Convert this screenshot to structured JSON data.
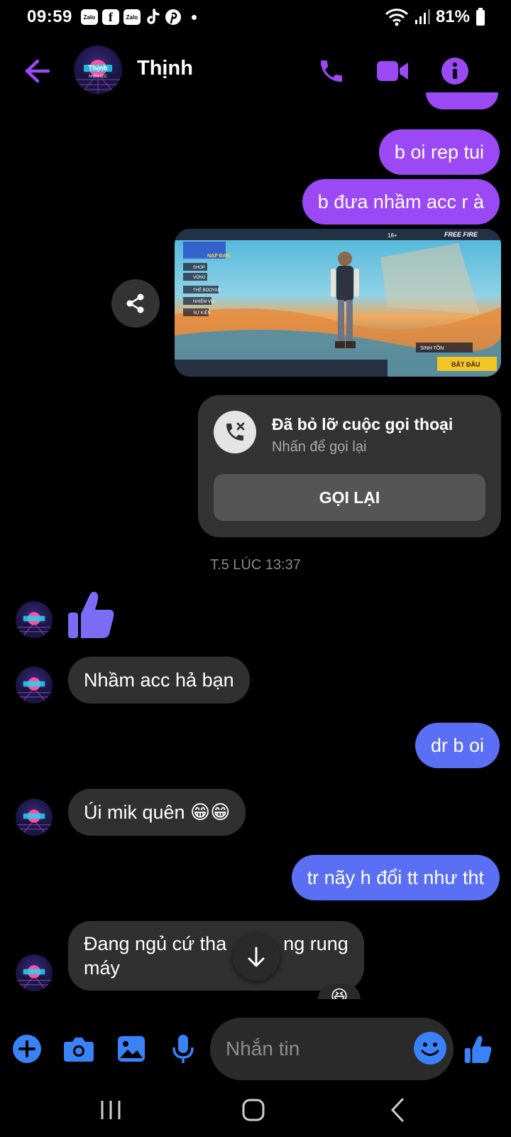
{
  "status_bar": {
    "time": "09:59",
    "notifications": [
      "Zalo",
      "f",
      "Zalo",
      "tiktok",
      "pinterest"
    ],
    "battery": "81%"
  },
  "header": {
    "contact_name": "Thịnh",
    "avatar_text": "Thịnh",
    "avatar_subtext": "NHẬN ACC"
  },
  "messages": {
    "out_1": "b oi rep tui",
    "out_2": "b đưa nhầm acc r à",
    "missed_call_title": "Đã bỏ lỡ cuộc gọi thoại",
    "missed_call_sub": "Nhấn để gọi lại",
    "callback_label": "GỌI LẠI",
    "timestamp": "T.5 LÚC 13:37",
    "in_1": "Nhầm acc hả bạn",
    "out_3": "dr b oi",
    "in_2": "Úi mik quên 😁😁",
    "out_4": "tr nãy h đổi tt như tht",
    "in_3_line1": "Đang ngủ cứ tha",
    "in_3_line1b": "ng rung",
    "in_3_line2": "máy",
    "reaction": "😆"
  },
  "game_image": {
    "top_banner": "NẠP ĐẠN",
    "menu_items": [
      "SHOP",
      "VÒNG",
      "THẺ BOOYAH",
      "NHIỆM VỤ",
      "SỰ KIỆN"
    ],
    "mode_label": "SINH TỒN",
    "start_label": "BẮT ĐẦU",
    "brand": "FREE FIRE",
    "age": "18+"
  },
  "composer": {
    "placeholder": "Nhắn tin"
  },
  "colors": {
    "accent_purple": "#9b48f5",
    "accent_blue": "#5b6ff5",
    "icon_blue": "#3a82f7"
  }
}
